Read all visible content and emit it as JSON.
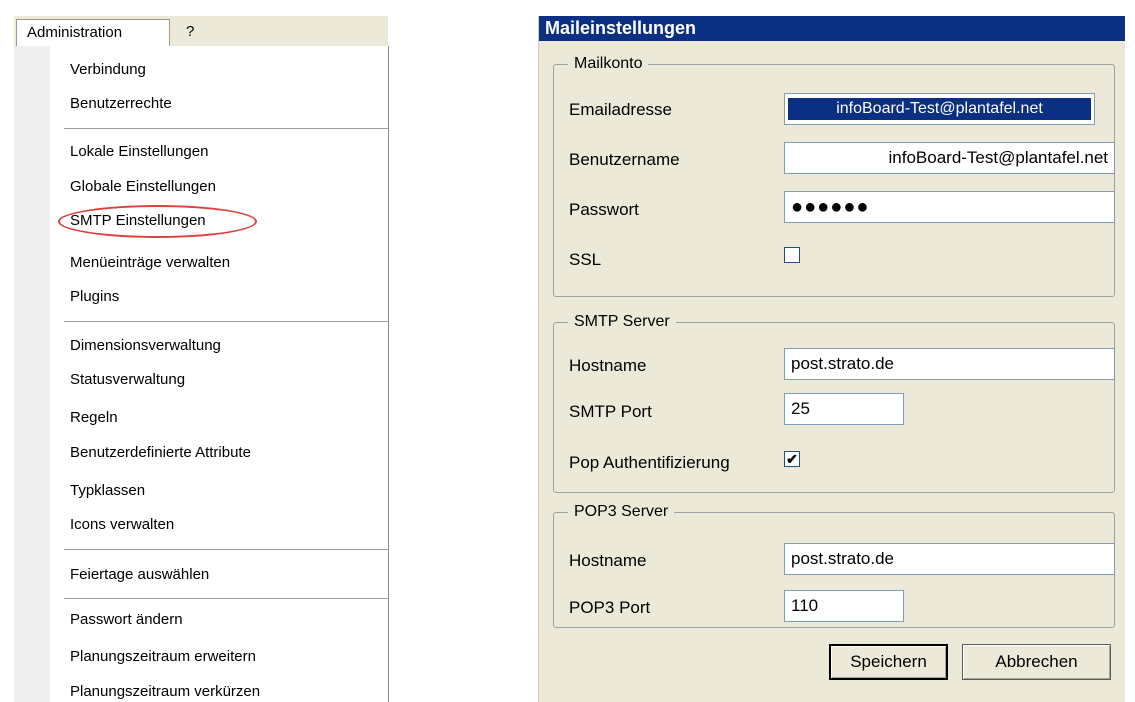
{
  "menu": {
    "menubar": {
      "admin": "Administration",
      "help": "?"
    },
    "items": [
      "Verbindung",
      "Benutzerrechte",
      "Lokale Einstellungen",
      "Globale Einstellungen",
      "SMTP Einstellungen",
      "Menüeinträge verwalten",
      "Plugins",
      "Dimensionsverwaltung",
      "Statusverwaltung",
      "Regeln",
      "Benutzerdefinierte Attribute",
      "Typklassen",
      "Icons verwalten",
      "Feiertage auswählen",
      "Passwort ändern",
      "Planungszeitraum erweitern",
      "Planungszeitraum verkürzen"
    ],
    "highlighted_item": "SMTP Einstellungen"
  },
  "dialog": {
    "title": "Maileinstellungen",
    "mailkonto": {
      "title": "Mailkonto",
      "email_label": "Emailadresse",
      "email_value": "infoBoard-Test@plantafel.net",
      "user_label": "Benutzername",
      "user_value": "infoBoard-Test@plantafel.net",
      "password_label": "Passwort",
      "password_value": "●●●●●●",
      "ssl_label": "SSL",
      "ssl_checked": false
    },
    "smtp": {
      "title": "SMTP Server",
      "host_label": "Hostname",
      "host_value": "post.strato.de",
      "port_label": "SMTP Port",
      "port_value": "25",
      "pop_auth_label": "Pop Authentifizierung",
      "pop_auth_checked": true,
      "pop_auth_mark": "✔"
    },
    "pop3": {
      "title": "POP3 Server",
      "host_label": "Hostname",
      "host_value": "post.strato.de",
      "port_label": "POP3 Port",
      "port_value": "110"
    },
    "buttons": {
      "save": "Speichern",
      "cancel": "Abbrechen"
    }
  },
  "colors": {
    "titlebar": "#0b2f82",
    "dialog_bg": "#ece9d8",
    "highlight_ellipse": "#e0403c"
  }
}
